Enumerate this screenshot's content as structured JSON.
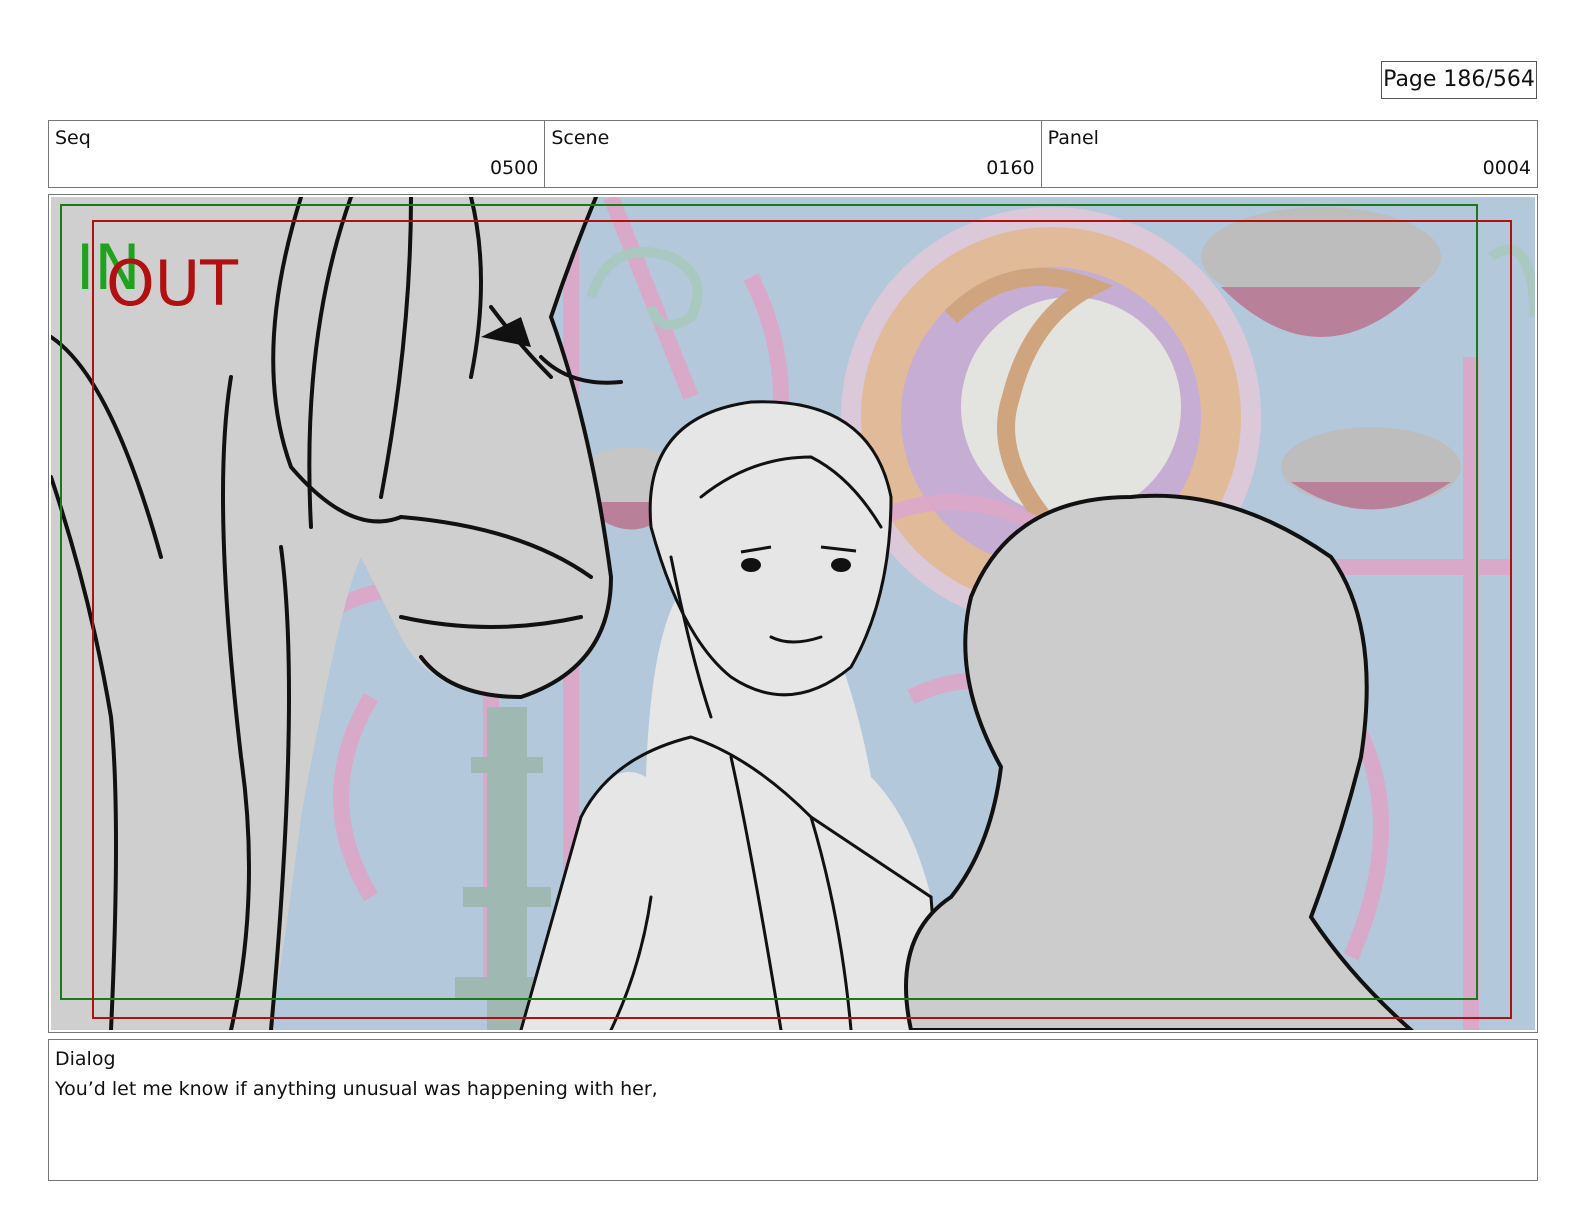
{
  "page": {
    "label": "Page 186/564"
  },
  "header": {
    "seq": {
      "label": "Seq",
      "value": "0500"
    },
    "scene": {
      "label": "Scene",
      "value": "0160"
    },
    "panel": {
      "label": "Panel",
      "value": "0004"
    }
  },
  "frame": {
    "in_label": "IN",
    "out_label": "OUT",
    "colors": {
      "in": "#1fa31f",
      "out": "#b01010",
      "sky": "#b4c8dc",
      "trellis": "#dba8c8",
      "sketch_fill": "#cccccc"
    }
  },
  "dialog": {
    "label": "Dialog",
    "text": "You’d let me know if anything unusual was happening with her,"
  }
}
